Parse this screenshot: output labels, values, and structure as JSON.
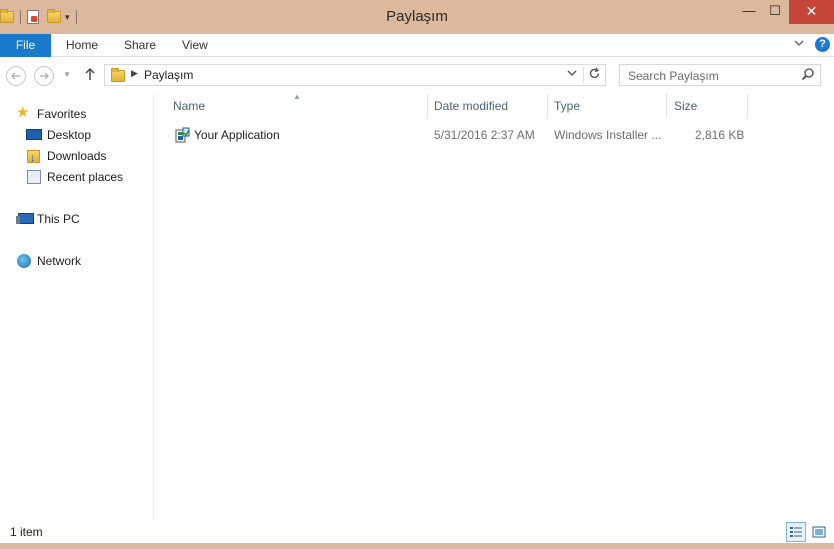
{
  "window": {
    "title": "Paylaşım",
    "minimize_glyph": "—",
    "maximize_glyph": "☐",
    "close_glyph": "✕"
  },
  "ribbon": {
    "tabs": [
      {
        "label": "File",
        "active": true
      },
      {
        "label": "Home"
      },
      {
        "label": "Share"
      },
      {
        "label": "View"
      }
    ],
    "help_label": "?"
  },
  "address": {
    "crumbs": [
      "Paylaşım"
    ]
  },
  "search": {
    "placeholder": "Search Paylaşım"
  },
  "nav_pane": {
    "favorites_label": "Favorites",
    "favorites": [
      {
        "label": "Desktop",
        "icon": "desktop-icon"
      },
      {
        "label": "Downloads",
        "icon": "downloads-folder-icon"
      },
      {
        "label": "Recent places",
        "icon": "recent-places-icon"
      }
    ],
    "this_pc_label": "This PC",
    "network_label": "Network"
  },
  "columns": {
    "name": "Name",
    "date_modified": "Date modified",
    "type": "Type",
    "size": "Size"
  },
  "files": [
    {
      "name": "Your Application",
      "date_modified": "5/31/2016 2:37 AM",
      "type": "Windows Installer ...",
      "size": "2,816 KB",
      "icon": "windows-installer-icon"
    }
  ],
  "status": {
    "item_count": "1 item"
  },
  "colors": {
    "titlebar": "#dcb99d",
    "file_tab": "#1979ca",
    "close_button": "#c7463a",
    "header_text": "#4c607a"
  }
}
